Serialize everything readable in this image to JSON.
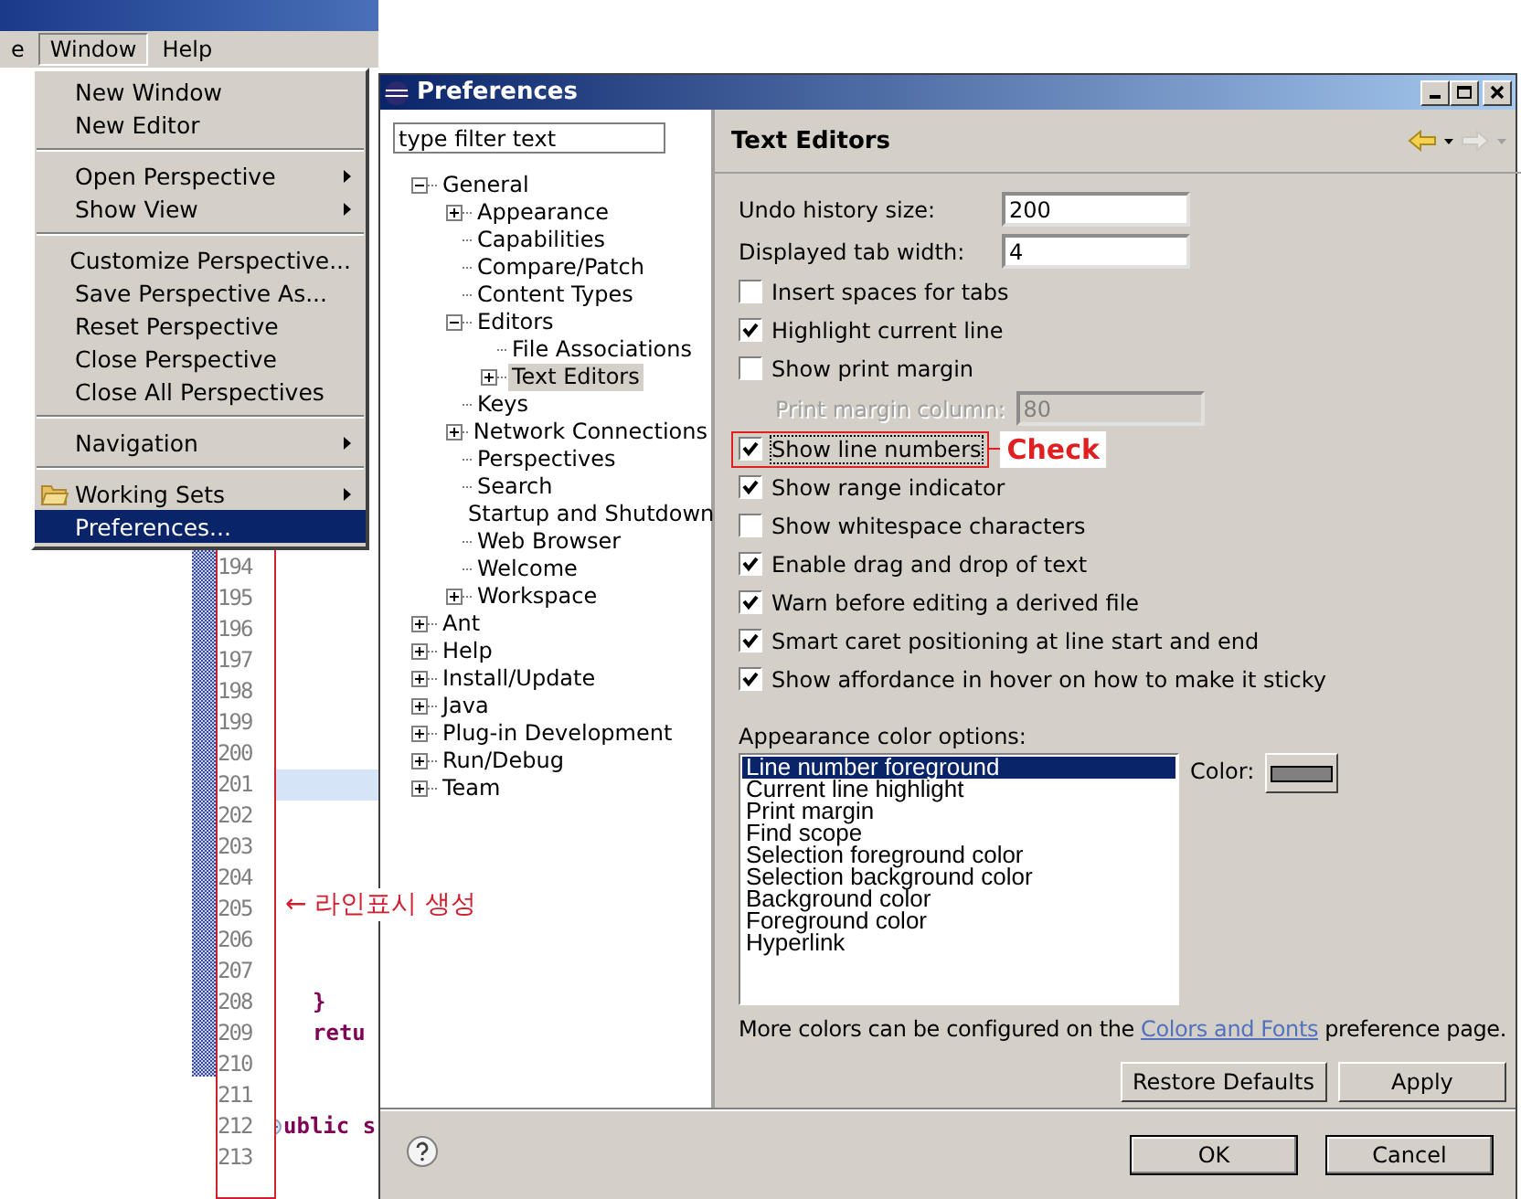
{
  "main_window": {
    "menubar": [
      {
        "label": "e",
        "selected": false
      },
      {
        "label": "Window",
        "selected": true
      },
      {
        "label": "Help",
        "selected": false
      }
    ]
  },
  "window_menu": {
    "items": [
      {
        "kind": "item",
        "label": "New Window",
        "submenu": false,
        "selected": false
      },
      {
        "kind": "item",
        "label": "New Editor",
        "submenu": false,
        "selected": false
      },
      {
        "kind": "separator"
      },
      {
        "kind": "item",
        "label": "Open Perspective",
        "submenu": true,
        "selected": false
      },
      {
        "kind": "item",
        "label": "Show View",
        "submenu": true,
        "selected": false
      },
      {
        "kind": "separator"
      },
      {
        "kind": "item",
        "label": "Customize Perspective...",
        "submenu": false,
        "selected": false
      },
      {
        "kind": "item",
        "label": "Save Perspective As...",
        "submenu": false,
        "selected": false
      },
      {
        "kind": "item",
        "label": "Reset Perspective",
        "submenu": false,
        "selected": false
      },
      {
        "kind": "item",
        "label": "Close Perspective",
        "submenu": false,
        "selected": false
      },
      {
        "kind": "item",
        "label": "Close All Perspectives",
        "submenu": false,
        "selected": false
      },
      {
        "kind": "separator"
      },
      {
        "kind": "item",
        "label": "Navigation",
        "submenu": true,
        "selected": false
      },
      {
        "kind": "separator"
      },
      {
        "kind": "folder-item",
        "label": "Working Sets",
        "submenu": true,
        "selected": false
      },
      {
        "kind": "item",
        "label": "Preferences...",
        "submenu": false,
        "selected": true
      }
    ]
  },
  "editor": {
    "callout": "← 라인표시 생성",
    "lines": [
      {
        "number": "194",
        "current": false
      },
      {
        "number": "195",
        "current": false
      },
      {
        "number": "196",
        "current": false
      },
      {
        "number": "197",
        "current": false
      },
      {
        "number": "198",
        "current": false
      },
      {
        "number": "199",
        "current": false
      },
      {
        "number": "200",
        "current": false
      },
      {
        "number": "201",
        "current": true
      },
      {
        "number": "202",
        "current": false
      },
      {
        "number": "203",
        "current": false
      },
      {
        "number": "204",
        "current": false
      },
      {
        "number": "205",
        "current": false
      },
      {
        "number": "206",
        "current": false
      },
      {
        "number": "207",
        "current": false
      },
      {
        "number": "208",
        "code": "}",
        "current": false
      },
      {
        "number": "209",
        "code": "retu",
        "current": false
      },
      {
        "number": "210",
        "current": false
      },
      {
        "number": "211",
        "current": false
      },
      {
        "number": "212",
        "code": "ublic s",
        "foldable": true,
        "current": false
      },
      {
        "number": "213",
        "current": false
      }
    ]
  },
  "dialog": {
    "title": "Preferences",
    "filter": {
      "value": "type filter text"
    },
    "tree": [
      {
        "label": "General",
        "expanded": true,
        "selected": false,
        "children": [
          {
            "label": "Appearance",
            "expanded": false,
            "selected": false
          },
          {
            "label": "Capabilities",
            "selected": false
          },
          {
            "label": "Compare/Patch",
            "selected": false
          },
          {
            "label": "Content Types",
            "selected": false
          },
          {
            "label": "Editors",
            "expanded": true,
            "selected": false,
            "children": [
              {
                "label": "File Associations",
                "selected": false
              },
              {
                "label": "Text Editors",
                "expanded": false,
                "selected": true
              }
            ]
          },
          {
            "label": "Keys",
            "selected": false
          },
          {
            "label": "Network Connections",
            "expanded": false,
            "selected": false
          },
          {
            "label": "Perspectives",
            "selected": false
          },
          {
            "label": "Search",
            "selected": false
          },
          {
            "label": "Startup and Shutdown",
            "selected": false
          },
          {
            "label": "Web Browser",
            "selected": false
          },
          {
            "label": "Welcome",
            "selected": false
          },
          {
            "label": "Workspace",
            "expanded": false,
            "selected": false
          }
        ]
      },
      {
        "label": "Ant",
        "expanded": false,
        "selected": false
      },
      {
        "label": "Help",
        "expanded": false,
        "selected": false
      },
      {
        "label": "Install/Update",
        "expanded": false,
        "selected": false
      },
      {
        "label": "Java",
        "expanded": false,
        "selected": false
      },
      {
        "label": "Plug-in Development",
        "expanded": false,
        "selected": false
      },
      {
        "label": "Run/Debug",
        "expanded": false,
        "selected": false
      },
      {
        "label": "Team",
        "expanded": false,
        "selected": false
      }
    ],
    "page_title": "Text Editors",
    "options": [
      {
        "kind": "field",
        "label": "Undo history size:",
        "value": "200",
        "disabled": false
      },
      {
        "kind": "field",
        "label": "Displayed tab width:",
        "value": "4",
        "disabled": false
      },
      {
        "kind": "checkbox",
        "label": "Insert spaces for tabs",
        "checked": false
      },
      {
        "kind": "checkbox",
        "label": "Highlight current line",
        "checked": true
      },
      {
        "kind": "checkbox",
        "label": "Show print margin",
        "checked": false
      },
      {
        "kind": "field",
        "label": "Print margin column:",
        "value": "80",
        "disabled": true
      },
      {
        "kind": "checkbox",
        "label": "Show line numbers",
        "checked": true,
        "callout": "Check"
      },
      {
        "kind": "checkbox",
        "label": "Show range indicator",
        "checked": true
      },
      {
        "kind": "checkbox",
        "label": "Show whitespace characters",
        "checked": false
      },
      {
        "kind": "checkbox",
        "label": "Enable drag and drop of text",
        "checked": true
      },
      {
        "kind": "checkbox",
        "label": "Warn before editing a derived file",
        "checked": true
      },
      {
        "kind": "checkbox",
        "label": "Smart caret positioning at line start and end",
        "checked": true
      },
      {
        "kind": "checkbox",
        "label": "Show affordance in hover on how to make it sticky",
        "checked": true
      }
    ],
    "colors": {
      "label": "Appearance color options:",
      "color_label": "Color:",
      "items": [
        {
          "label": "Line number foreground",
          "selected": true
        },
        {
          "label": "Current line highlight",
          "selected": false
        },
        {
          "label": "Print margin",
          "selected": false
        },
        {
          "label": "Find scope",
          "selected": false
        },
        {
          "label": "Selection foreground color",
          "selected": false
        },
        {
          "label": "Selection background color",
          "selected": false
        },
        {
          "label": "Background color",
          "selected": false
        },
        {
          "label": "Foreground color",
          "selected": false
        },
        {
          "label": "Hyperlink",
          "selected": false
        }
      ]
    },
    "info": {
      "before": "More colors can be configured on the ",
      "link": "Colors and Fonts",
      "after": " preference page."
    },
    "page_buttons": [
      "Restore Defaults",
      "Apply"
    ],
    "dialog_buttons": [
      "OK",
      "Cancel"
    ]
  }
}
